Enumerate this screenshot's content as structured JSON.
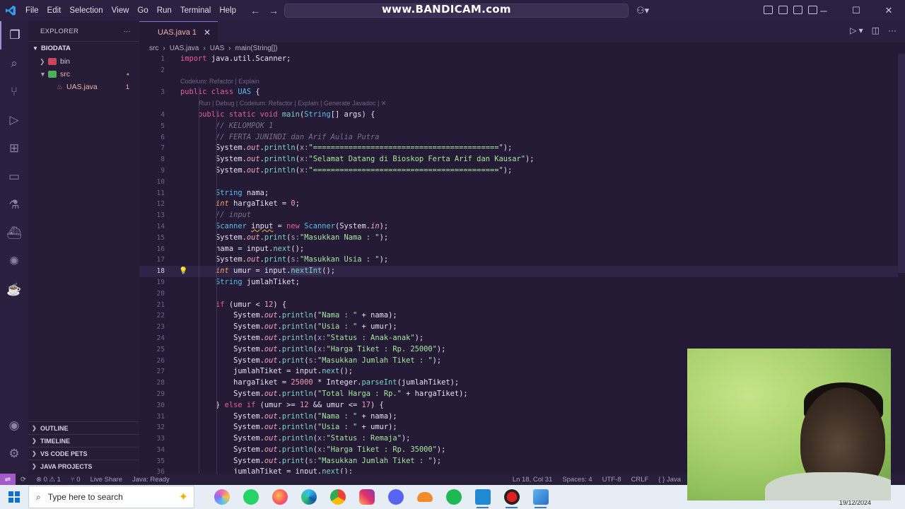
{
  "titlebar": {
    "menu": [
      "File",
      "Edit",
      "Selection",
      "View",
      "Go",
      "Run",
      "Terminal",
      "Help"
    ],
    "watermark": "www.BANDICAM.com"
  },
  "sidebar": {
    "title": "EXPLORER",
    "more": "···",
    "folder": "BIODATA",
    "tree": [
      {
        "label": "bin",
        "badge": ""
      },
      {
        "label": "src",
        "badge": "●"
      },
      {
        "label": "UAS.java",
        "badge": "1"
      }
    ],
    "sections": [
      "OUTLINE",
      "TIMELINE",
      "VS CODE PETS",
      "JAVA PROJECTS"
    ]
  },
  "editor": {
    "tab": {
      "label": "UAS.java 1",
      "close": "✕"
    },
    "breadcrumb": [
      "src",
      "UAS.java",
      "UAS",
      "main(String[])"
    ],
    "lines": [
      {
        "n": "1",
        "html": "<span class='kw'>import</span> <span class='plain'>java.util.Scanner;</span>"
      },
      {
        "n": "2",
        "html": ""
      },
      {
        "lens": "Codeium: Refactor | Explain"
      },
      {
        "n": "3",
        "html": "<span class='kw'>public class</span> <span class='ty'>UAS</span> <span class='plain'>{</span>"
      },
      {
        "lens": "Run | Debug | Codeium: Refactor | Explain | Generate Javadoc | ✕",
        "indent": 1
      },
      {
        "n": "4",
        "html": "    <span class='kw'>public static void</span> <span class='fn'>main</span><span class='plain'>(</span><span class='ty'>String</span><span class='plain'>[] </span><span class='plain'>args) {</span>"
      },
      {
        "n": "5",
        "html": "        <span class='cm'>// KELOMPOK 1</span>"
      },
      {
        "n": "6",
        "html": "        <span class='cm'>// FERTA JUNINDI dan Arif Aulia Putra</span>"
      },
      {
        "n": "7",
        "html": "        <span class='plain'>System.</span><span class='out'>out</span><span class='plain'>.</span><span class='fn'>println</span><span class='plain'>(</span><span class='param'>x:</span><span class='str'>\"==========================================\"</span><span class='plain'>);</span>"
      },
      {
        "n": "8",
        "html": "        <span class='plain'>System.</span><span class='out'>out</span><span class='plain'>.</span><span class='fn'>println</span><span class='plain'>(</span><span class='param'>x:</span><span class='str'>\"Selamat Datang di Bioskop Ferta Arif dan Kausar\"</span><span class='plain'>);</span>"
      },
      {
        "n": "9",
        "html": "        <span class='plain'>System.</span><span class='out'>out</span><span class='plain'>.</span><span class='fn'>println</span><span class='plain'>(</span><span class='param'>x:</span><span class='str'>\"==========================================\"</span><span class='plain'>);</span>"
      },
      {
        "n": "10",
        "html": ""
      },
      {
        "n": "11",
        "html": "        <span class='ty'>String</span> <span class='plain'>nama;</span>"
      },
      {
        "n": "12",
        "html": "        <span class='kw2'>int</span> <span class='plain'>hargaTiket = </span><span class='num'>0</span><span class='plain'>;</span>"
      },
      {
        "n": "13",
        "html": "        <span class='cm'>// input</span>"
      },
      {
        "n": "14",
        "html": "        <span class='ty'>Scanner</span> <span class='plain' style='text-decoration: underline wavy #d9a23c;'>input</span><span class='plain'> = </span><span class='kw'>new</span> <span class='ty'>Scanner</span><span class='plain'>(System.</span><span class='out'>in</span><span class='plain'>);</span>"
      },
      {
        "n": "15",
        "html": "        <span class='plain'>System.</span><span class='out'>out</span><span class='plain'>.</span><span class='fn'>print</span><span class='plain'>(</span><span class='param'>s:</span><span class='str'>\"Masukkan Nama : \"</span><span class='plain'>);</span>"
      },
      {
        "n": "16",
        "html": "        <span class='plain'>nama = input.</span><span class='fn'>next</span><span class='plain'>();</span>"
      },
      {
        "n": "17",
        "html": "        <span class='plain'>System.</span><span class='out'>out</span><span class='plain'>.</span><span class='fn'>print</span><span class='plain'>(</span><span class='param'>s:</span><span class='str'>\"Masukkan Usia : \"</span><span class='plain'>);</span>"
      },
      {
        "n": "18",
        "html": "        <span class='kw2'>int</span> <span class='plain'>umur = input.</span><span class='fn' style='background:#3d3258;'>nextInt</span><span class='plain'>();</span>",
        "current": true
      },
      {
        "n": "19",
        "html": "        <span class='ty'>String</span> <span class='plain'>jumlahTiket;</span>"
      },
      {
        "n": "20",
        "html": ""
      },
      {
        "n": "21",
        "html": "        <span class='kw'>if</span> <span class='plain'>(umur &lt; </span><span class='num'>12</span><span class='plain'>) {</span>"
      },
      {
        "n": "22",
        "html": "            <span class='plain'>System.</span><span class='out'>out</span><span class='plain'>.</span><span class='fn'>println</span><span class='plain'>(</span><span class='str'>\"Nama : \"</span><span class='plain'> + nama);</span>"
      },
      {
        "n": "23",
        "html": "            <span class='plain'>System.</span><span class='out'>out</span><span class='plain'>.</span><span class='fn'>println</span><span class='plain'>(</span><span class='str'>\"Usia : \"</span><span class='plain'> + umur);</span>"
      },
      {
        "n": "24",
        "html": "            <span class='plain'>System.</span><span class='out'>out</span><span class='plain'>.</span><span class='fn'>println</span><span class='plain'>(</span><span class='param'>x:</span><span class='str'>\"Status : Anak-anak\"</span><span class='plain'>);</span>"
      },
      {
        "n": "25",
        "html": "            <span class='plain'>System.</span><span class='out'>out</span><span class='plain'>.</span><span class='fn'>println</span><span class='plain'>(</span><span class='param'>x:</span><span class='str'>\"Harga Tiket : Rp. 25000\"</span><span class='plain'>);</span>"
      },
      {
        "n": "26",
        "html": "            <span class='plain'>System.</span><span class='out'>out</span><span class='plain'>.</span><span class='fn'>print</span><span class='plain'>(</span><span class='param'>s:</span><span class='str'>\"Masukkan Jumlah Tiket : \"</span><span class='plain'>);</span>"
      },
      {
        "n": "27",
        "html": "            <span class='plain'>jumlahTiket = input.</span><span class='fn'>next</span><span class='plain'>();</span>"
      },
      {
        "n": "28",
        "html": "            <span class='plain'>hargaTiket = </span><span class='num'>25000</span><span class='plain'> * Integer.</span><span class='fn'>parseInt</span><span class='plain'>(jumlahTiket);</span>"
      },
      {
        "n": "29",
        "html": "            <span class='plain'>System.</span><span class='out'>out</span><span class='plain'>.</span><span class='fn'>println</span><span class='plain'>(</span><span class='str'>\"Total Harga : Rp.\"</span><span class='plain'> + hargaTiket);</span>"
      },
      {
        "n": "30",
        "html": "        <span class='plain'>} </span><span class='kw'>else if</span> <span class='plain'>(umur &gt;= </span><span class='num'>12</span><span class='plain'> &amp;&amp; umur &lt;= </span><span class='num'>17</span><span class='plain'>) {</span>"
      },
      {
        "n": "31",
        "html": "            <span class='plain'>System.</span><span class='out'>out</span><span class='plain'>.</span><span class='fn'>println</span><span class='plain'>(</span><span class='str'>\"Nama : \"</span><span class='plain'> + nama);</span>"
      },
      {
        "n": "32",
        "html": "            <span class='plain'>System.</span><span class='out'>out</span><span class='plain'>.</span><span class='fn'>println</span><span class='plain'>(</span><span class='str'>\"Usia : \"</span><span class='plain'> + umur);</span>"
      },
      {
        "n": "33",
        "html": "            <span class='plain'>System.</span><span class='out'>out</span><span class='plain'>.</span><span class='fn'>println</span><span class='plain'>(</span><span class='param'>x:</span><span class='str'>\"Status : Remaja\"</span><span class='plain'>);</span>"
      },
      {
        "n": "34",
        "html": "            <span class='plain'>System.</span><span class='out'>out</span><span class='plain'>.</span><span class='fn'>println</span><span class='plain'>(</span><span class='param'>x:</span><span class='str'>\"Harga Tiket : Rp. 35000\"</span><span class='plain'>);</span>"
      },
      {
        "n": "35",
        "html": "            <span class='plain'>System.</span><span class='out'>out</span><span class='plain'>.</span><span class='fn'>print</span><span class='plain'>(</span><span class='param'>s:</span><span class='str'>\"Masukkan Jumlah Tiket : \"</span><span class='plain'>);</span>"
      },
      {
        "n": "36",
        "html": "            <span class='plain'>jumlahTiket = input.</span><span class='fn'>next</span><span class='plain'>();</span>"
      }
    ]
  },
  "statusbar": {
    "errors": "⊗ 0 ⚠ 1",
    "ports": "⑂ 0",
    "liveshare": "Live Share",
    "java": "Java: Ready",
    "position": "Ln 18, Col 31",
    "spaces": "Spaces: 4",
    "encoding": "UTF-8",
    "eol": "CRLF",
    "language": "{ } Java"
  },
  "taskbar": {
    "search_placeholder": "Type here to search",
    "date": "19/12/2024"
  },
  "colors": {
    "accent": "#a45ac9",
    "editor_bg": "#241a35"
  }
}
